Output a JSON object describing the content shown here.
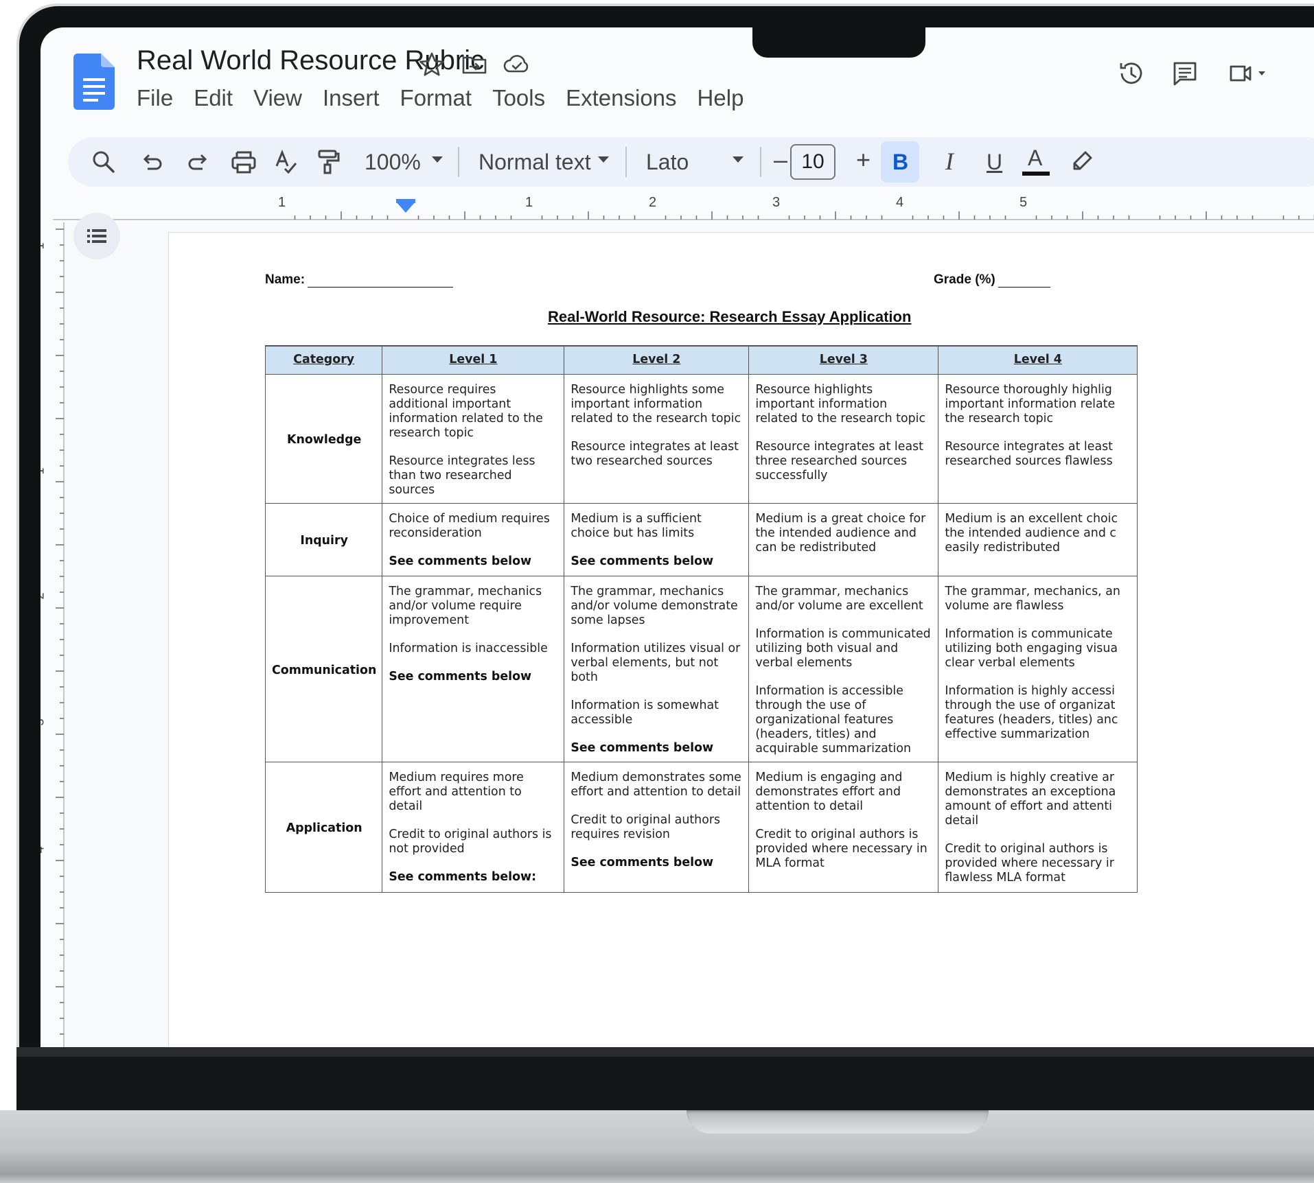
{
  "app": {
    "doc_title": "Real World Resource Rubric",
    "menu": [
      "File",
      "Edit",
      "View",
      "Insert",
      "Format",
      "Tools",
      "Extensions",
      "Help"
    ]
  },
  "toolbar": {
    "zoom": "100%",
    "style": "Normal text",
    "font": "Lato",
    "font_size": "10",
    "minus": "–",
    "plus": "+",
    "bold": "B",
    "italic": "I",
    "underline": "U",
    "text_color": "A"
  },
  "ruler": {
    "h_numbers": [
      "1",
      "1",
      "2",
      "3",
      "4",
      "5"
    ],
    "v_numbers": [
      "1",
      "1",
      "2",
      "3",
      "4"
    ]
  },
  "document": {
    "name_label": "Name:",
    "grade_label": "Grade (%)",
    "heading": "Real-World Resource: Research Essay Application",
    "table": {
      "headers": [
        "Category",
        "Level 1",
        "Level 2",
        "Level 3",
        "Level 4"
      ],
      "rows": [
        {
          "category": "Knowledge",
          "cells": [
            [
              "Resource requires additional important information related to the research topic",
              "Resource integrates less than two researched sources"
            ],
            [
              "Resource highlights some important information related to the research topic",
              "Resource integrates at least two researched sources"
            ],
            [
              "Resource highlights important information related to the research topic",
              "Resource integrates at least three researched sources successfully"
            ],
            [
              "Resource thoroughly highlig important information relate the research topic",
              "Resource integrates at least researched sources flawless"
            ]
          ]
        },
        {
          "category": "Inquiry",
          "cells": [
            [
              "Choice of medium requires reconsideration",
              "See comments below"
            ],
            [
              "Medium is a sufficient choice but has limits",
              "See comments below"
            ],
            [
              "Medium is a great choice for the intended audience and can be redistributed"
            ],
            [
              "Medium is an excellent choic the intended audience and c easily redistributed"
            ]
          ]
        },
        {
          "category": "Communication",
          "cells": [
            [
              "The grammar, mechanics and/or volume require improvement",
              "Information is inaccessible",
              "See comments below"
            ],
            [
              "The grammar, mechanics and/or volume demonstrate some lapses",
              "Information utilizes visual or verbal elements, but not both",
              "Information is somewhat accessible",
              "See comments below"
            ],
            [
              "The grammar, mechanics and/or volume are excellent",
              "Information is communicated utilizing both visual and verbal elements",
              "Information is accessible through the use of organizational features (headers, titles) and acquirable summarization"
            ],
            [
              "The grammar, mechanics, an volume are flawless",
              "Information is communicate utilizing both engaging visua clear verbal elements",
              "Information is highly accessi through the use of organizat features (headers, titles) anc effective summarization"
            ]
          ]
        },
        {
          "category": "Application",
          "cells": [
            [
              "Medium requires more effort and attention to detail",
              "Credit to original authors is not provided",
              "See comments below:"
            ],
            [
              "Medium demonstrates some effort and attention to detail",
              "Credit to original authors requires revision",
              "See comments below"
            ],
            [
              "Medium is engaging and demonstrates effort and attention to detail",
              "Credit to original authors is provided where necessary in MLA format"
            ],
            [
              "Medium is highly creative ar demonstrates an exceptiona amount of effort and attenti detail",
              "Credit to original authors is provided where necessary ir flawless MLA format"
            ]
          ]
        }
      ]
    }
  },
  "colors": {
    "accent_blue": "#4285f4",
    "header_fill": "#cfe2f3",
    "toolbar_bg": "#edf2fa",
    "bold_active": "#d3e3fd"
  }
}
